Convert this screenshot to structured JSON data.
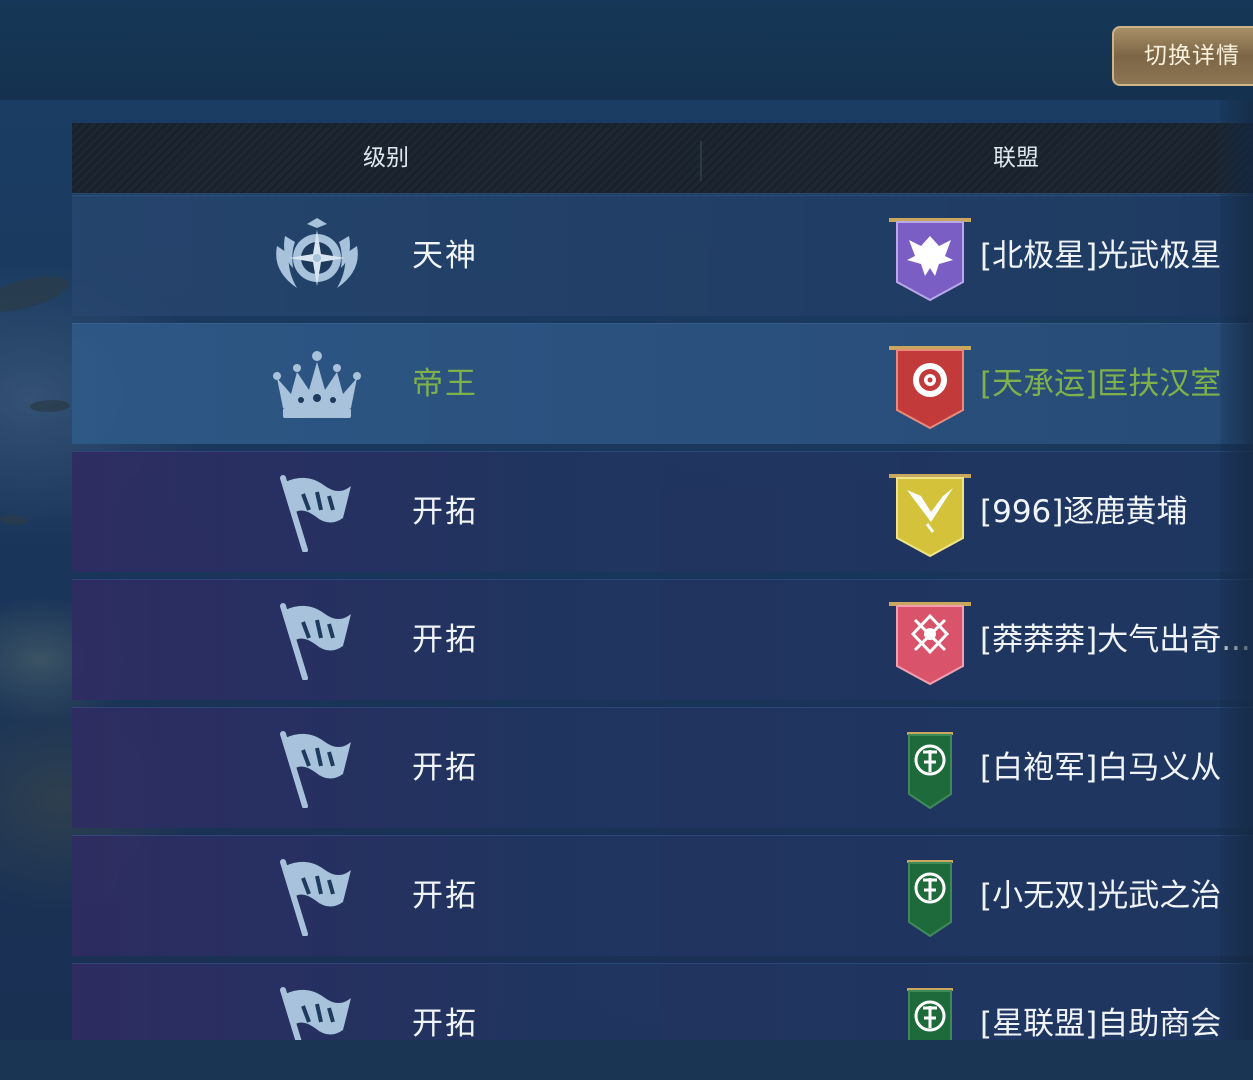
{
  "header": {
    "switch_button_label": "切换详情"
  },
  "table": {
    "columns": {
      "level": "级别",
      "alliance": "联盟"
    },
    "rows": [
      {
        "level": "天神",
        "level_icon": "compass-wreath-icon",
        "alliance": "[北极星]光武极星",
        "banner_color": "#7a5ec4",
        "banner_icon": "eagle-icon",
        "highlight": false
      },
      {
        "level": "帝王",
        "level_icon": "crown-icon",
        "alliance": "[天承运]匡扶汉室",
        "banner_color": "#c23a3a",
        "banner_icon": "rose-icon",
        "highlight": true
      },
      {
        "level": "开拓",
        "level_icon": "flag-icon",
        "alliance": "[996]逐鹿黄埔",
        "banner_color": "#d3c23a",
        "banner_icon": "bird-icon",
        "highlight": false
      },
      {
        "level": "开拓",
        "level_icon": "flag-icon",
        "alliance": "[莽莽莽]大气出奇...",
        "banner_color": "#d9546b",
        "banner_icon": "axes-icon",
        "highlight": false
      },
      {
        "level": "开拓",
        "level_icon": "flag-icon",
        "alliance": "[白袍军]白马义从",
        "banner_color": "#1f6a3a",
        "banner_icon": "shield-wreath-icon",
        "highlight": false
      },
      {
        "level": "开拓",
        "level_icon": "flag-icon",
        "alliance": "[小无双]光武之治",
        "banner_color": "#1f6a3a",
        "banner_icon": "shield-wreath-icon",
        "highlight": false
      },
      {
        "level": "开拓",
        "level_icon": "flag-icon",
        "alliance": "[星联盟]自助商会",
        "banner_color": "#1f6a3a",
        "banner_icon": "shield-wreath-icon",
        "highlight": false
      }
    ]
  }
}
